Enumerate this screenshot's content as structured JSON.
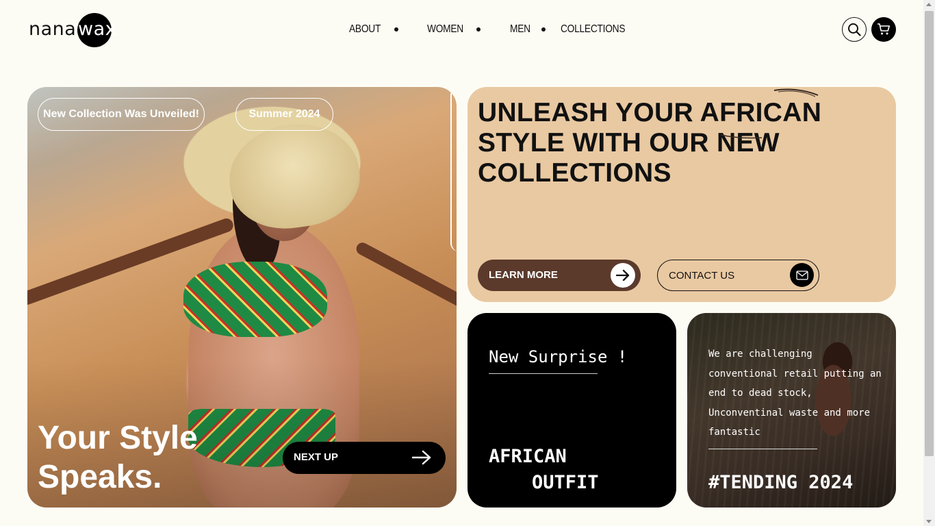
{
  "brand": {
    "logo_part1": "nana",
    "logo_part2": "wax"
  },
  "nav": {
    "items": [
      "ABOUT",
      "WOMEN",
      "MEN",
      "COLLECTIONS"
    ]
  },
  "header": {
    "search_icon": "search-icon",
    "cart_icon": "cart-icon"
  },
  "hero": {
    "pill_new_collection": "New Collection Was Unveiled!",
    "pill_season": "Summer 2024",
    "title_line1": "Your Style",
    "title_line2": "Speaks.",
    "next_label": "NEXT UP"
  },
  "promo": {
    "headline_line1": "UNLEASH YOUR AFRICAN",
    "headline_line2": "STYLE WITH OUR NEW",
    "headline_line3": "COLLECTIONS",
    "learn_more": "LEARN MORE",
    "contact_us": "CONTACT US",
    "accent_color": "#e9c9a2",
    "button_color": "#5b3a2c"
  },
  "surprise_card": {
    "heading": "New Surprise !",
    "line1": "AFRICAN",
    "line2": "OUTFIT"
  },
  "trend_card": {
    "line1": "We are challenging",
    "line2": "conventional retail putting an",
    "line3": "end to dead stock,",
    "line4": "Unconventinal waste and more",
    "line5": "fantastic",
    "tag": "#TENDING 2024"
  }
}
